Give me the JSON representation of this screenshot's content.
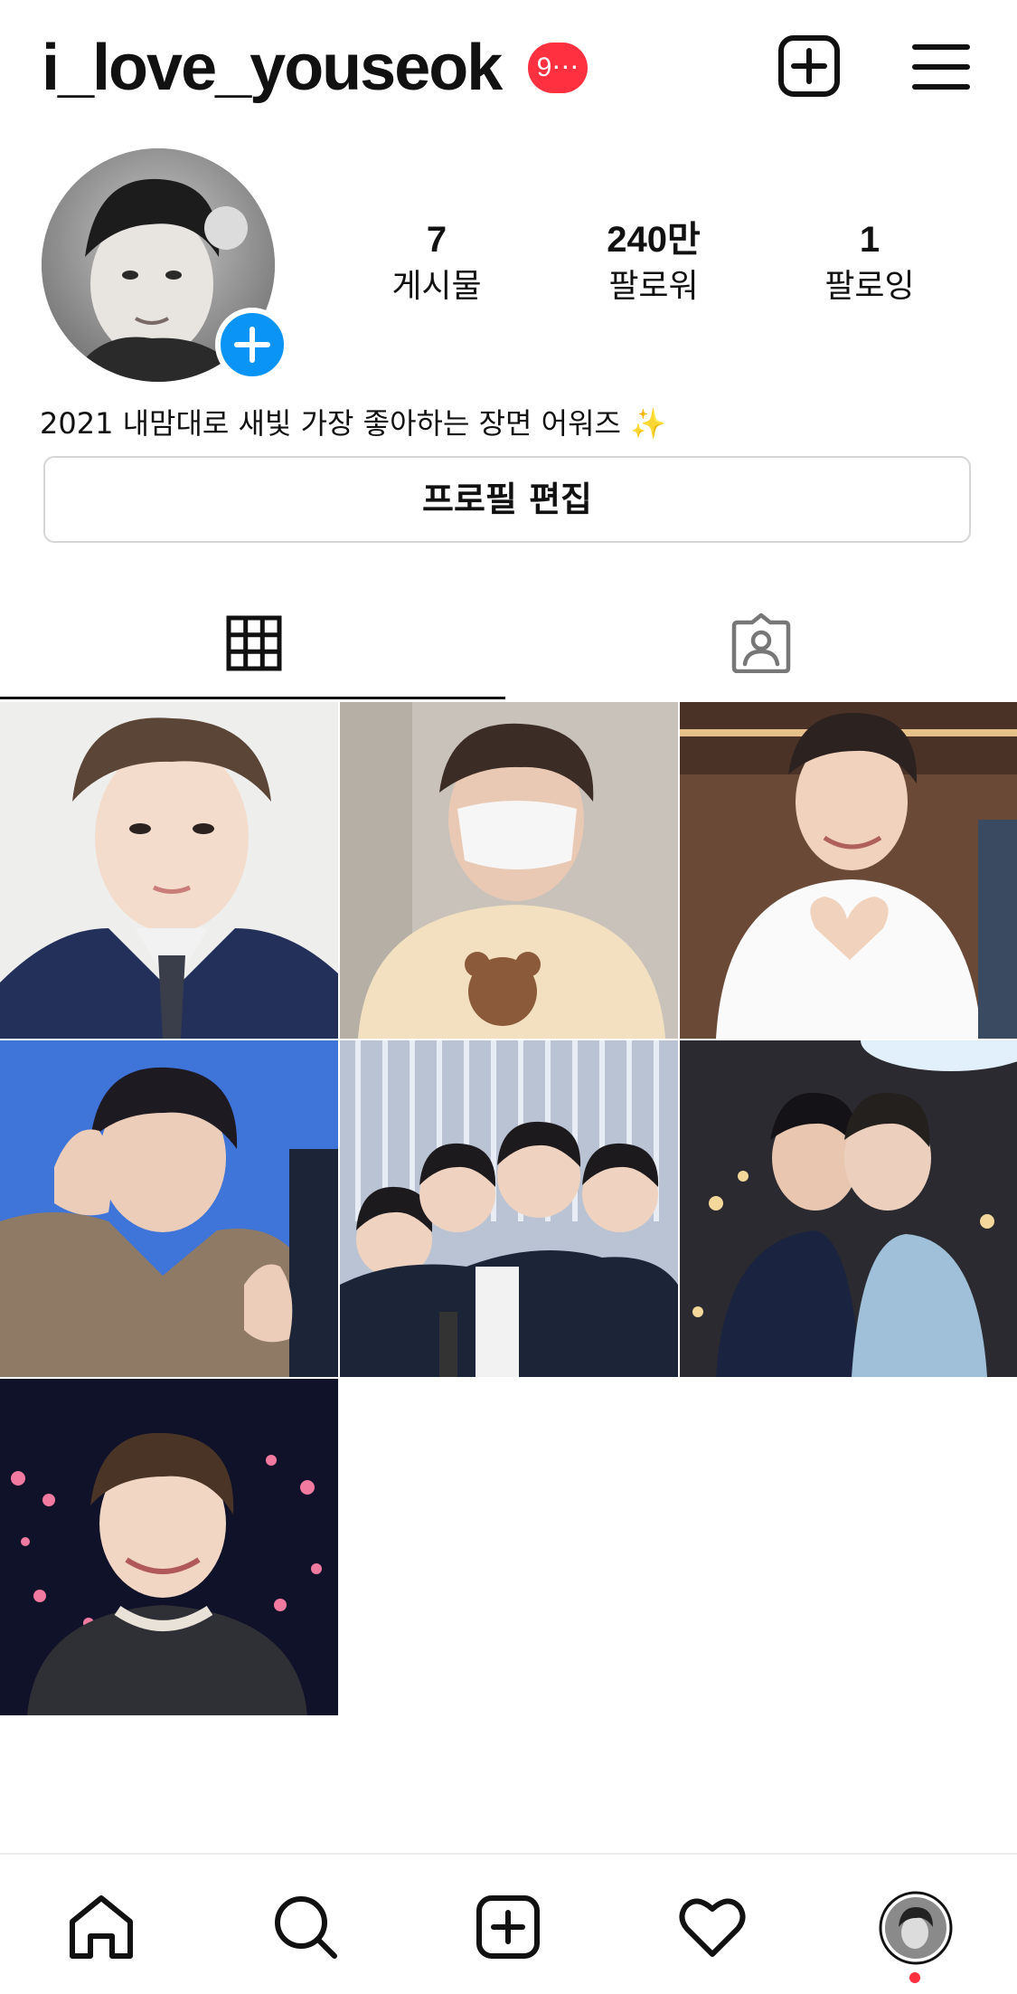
{
  "header": {
    "username": "i_love_youseok",
    "notification_badge": "9⋯",
    "create_icon": "plus-square-icon",
    "menu_icon": "hamburger-menu-icon"
  },
  "profile": {
    "stats": [
      {
        "count": "7",
        "label": "게시물"
      },
      {
        "count": "240만",
        "label": "팔로워"
      },
      {
        "count": "1",
        "label": "팔로잉"
      }
    ],
    "bio": "2021 내맘대로 새빛 가장 좋아하는 장면 어워즈 ✨",
    "edit_button_label": "프로필 편집"
  },
  "tabs": [
    {
      "icon": "grid-icon",
      "selected": true
    },
    {
      "icon": "tagged-person-icon",
      "selected": false
    }
  ],
  "posts": [
    {
      "index": 1
    },
    {
      "index": 2
    },
    {
      "index": 3
    },
    {
      "index": 4
    },
    {
      "index": 5
    },
    {
      "index": 6
    },
    {
      "index": 7
    }
  ],
  "bottom_nav": [
    {
      "icon": "home-icon"
    },
    {
      "icon": "search-icon"
    },
    {
      "icon": "create-post-icon"
    },
    {
      "icon": "heart-icon"
    },
    {
      "icon": "profile-avatar-icon",
      "has_notification_dot": true
    }
  ],
  "colors": {
    "accent_blue": "#0a95f6",
    "badge_red": "#ff3040",
    "text": "#111111",
    "border": "#d6d6d6"
  }
}
